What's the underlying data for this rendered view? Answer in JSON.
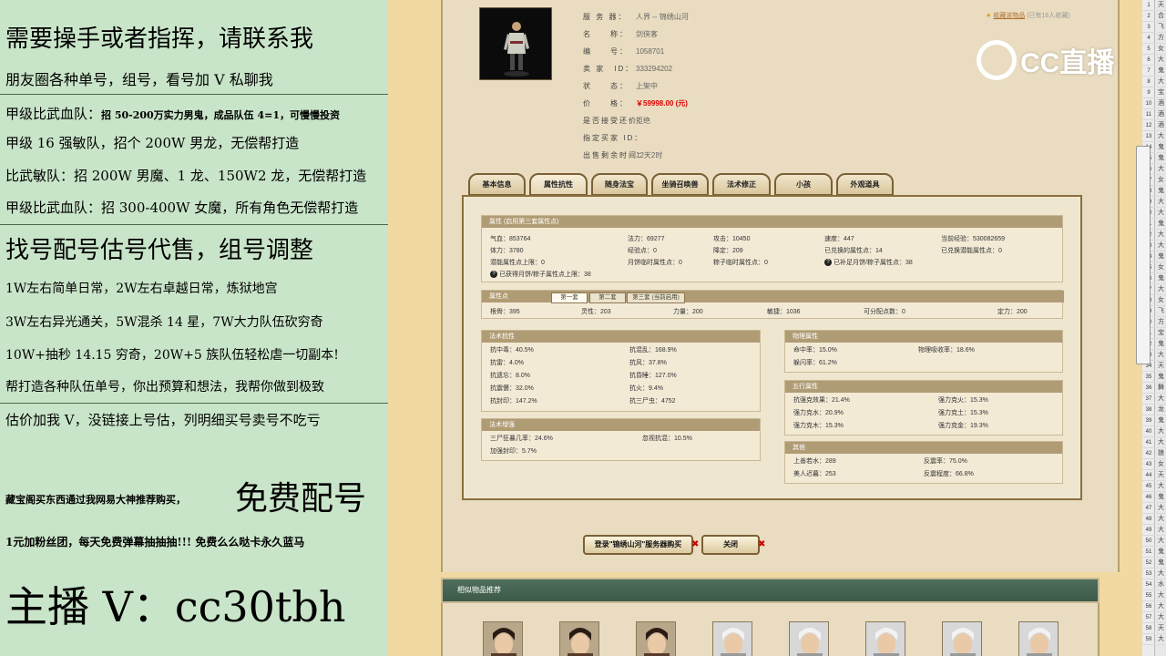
{
  "left_panel": {
    "title": "需要操手或者指挥，请联系我",
    "line1": "朋友圈各种单号，组号，看号加 V 私聊我",
    "recruit": [
      {
        "prefix": "甲级比武血队：",
        "text": "招 50-200万实力男鬼，成品队伍 4=1，可慢慢投资"
      },
      {
        "prefix": "",
        "text": "甲级 16 强敏队，招个 200W 男龙，无偿帮打造"
      },
      {
        "prefix": "",
        "text": "比武敏队：招 200W 男魔、1 龙、150W2 龙，无偿帮打造"
      },
      {
        "prefix": "",
        "text": "甲级比武血队：招 300-400W 女魔，所有角色无偿帮打造"
      }
    ],
    "title2": "找号配号估号代售，组号调整",
    "service": [
      "1W左右简单日常，2W左右卓越日常，炼狱地宫",
      "3W左右异光通关，5W混杀 14 星，7W大力队伍砍穷奇",
      "10W+抽秒 14.15 穷奇，20W+5 族队伍轻松虐一切副本!",
      "帮打造各种队伍单号，你出预算和想法，我帮你做到极致"
    ],
    "line_eval": "估价加我 V，没链接上号估，列明细买号卖号不吃亏",
    "cbg_small": "藏宝阁买东西通过我网易大神推荐购买，",
    "cbg_big": "免费配号",
    "fans": "1元加粉丝团，每天免费弹幕抽抽抽!!! 免费么么哒卡永久蓝马",
    "anchor": "主播 V：cc30tbh"
  },
  "item": {
    "rows": [
      {
        "label": "服 务 器：",
        "value": "人界 -- 锦绣山河"
      },
      {
        "label": "名　　称：",
        "value": "剑侠客"
      },
      {
        "label": "编　　号：",
        "value": "1058701"
      },
      {
        "label": "卖 家　ID：",
        "value": "333294202"
      },
      {
        "label": "状　　态：",
        "value": "上架中"
      },
      {
        "label": "价　　格：",
        "value": "￥59998.00 (元)"
      },
      {
        "label": "是否接受还价：",
        "value": "拒绝"
      },
      {
        "label": "指定买家 ID：",
        "value": ""
      },
      {
        "label": "出售剩余时间：",
        "value": "12天2时"
      }
    ],
    "fav_link": "收藏该物品",
    "fav_count": "(已有16人收藏)"
  },
  "tabs": [
    "基本信息",
    "属性抗性",
    "随身法宝",
    "坐骑召唤兽",
    "法术修正",
    "小孩",
    "外观道具"
  ],
  "attr": {
    "header": "属性 (启用第三套属性点)",
    "cells": [
      "气血：853764",
      "法力：69277",
      "攻击：10450",
      "速度：447",
      "当前经验：530082659",
      "体力：3780",
      "经验点：0",
      "降定：209",
      "已兑换的属性点：14",
      "已兑换潜能属性点：0",
      "潜能属性点上限：0",
      "月饼临时属性点：0",
      "粽子临时属性点：0",
      "已补足月饼/粽子属性点：38",
      "已获得月饼/粽子属性点上限：38"
    ]
  },
  "points": {
    "header": "属性点",
    "tabs": [
      "第一套",
      "第二套",
      "第三套 (当前启用)"
    ],
    "cells": [
      "根骨：395",
      "灵性：203",
      "力量：200",
      "敏捷：1036",
      "可分配点数：0",
      "定力：200"
    ]
  },
  "spell_res": {
    "header": "法术抗性",
    "cells": [
      "抗中毒：40.5%",
      "抗混乱：168.9%",
      "抗雷：4.0%",
      "抗风：37.8%",
      "抗遗忘：8.0%",
      "抗昏睡：127.0%",
      "抗震慑：32.0%",
      "抗火：9.4%",
      "抗封印：147.2%",
      "抗三尸虫：4752"
    ]
  },
  "phys": {
    "header": "物理属性",
    "cells": [
      "命中率：15.0%",
      "物理吸收率：18.6%",
      "躲闪率：61.2%"
    ]
  },
  "spell_boost": {
    "header": "法术增强",
    "cells": [
      "三尸狂暴几率：24.6%",
      "忽视抗混：10.5%",
      "加强封印：5.7%"
    ]
  },
  "wuxing": {
    "header": "五行属性",
    "cells": [
      "抗强克效果：21.4%",
      "强力克火：15.3%",
      "强力克水：20.9%",
      "强力克土：15.3%",
      "强力克木：15.3%",
      "强力克金：19.3%"
    ]
  },
  "other": {
    "header": "其他",
    "cells": [
      "上善若水：289",
      "反震率：75.0%",
      "美人迟暮：253",
      "反震程度：66.8%"
    ]
  },
  "buttons": {
    "login": "登录\"锦绣山河\"服务器购买",
    "close": "关闭"
  },
  "similar_title": "相似物品推荐",
  "logo_text": "CC直播",
  "strip": {
    "rows": [
      "1",
      "2",
      "3",
      "4",
      "5",
      "6",
      "7",
      "8",
      "9",
      "10",
      "11",
      "12",
      "13",
      "14",
      "15",
      "16",
      "17",
      "18",
      "19",
      "20",
      "21",
      "22",
      "23",
      "24",
      "25",
      "26",
      "27",
      "28",
      "29",
      "30",
      "31",
      "32",
      "33",
      "34",
      "35",
      "36",
      "37",
      "38",
      "39",
      "40",
      "41",
      "42",
      "43",
      "44",
      "45",
      "46",
      "47",
      "48",
      "49",
      "50",
      "51",
      "52",
      "53",
      "54",
      "55",
      "56",
      "57",
      "58",
      "59"
    ],
    "glyphs": [
      "天",
      "合",
      "飞",
      "方",
      "女",
      "大",
      "鬼",
      "大",
      "宝",
      "酒",
      "酒",
      "酒",
      "大",
      "鬼",
      "鬼",
      "大",
      "女",
      "鬼",
      "大",
      "大",
      "鬼",
      "大",
      "大",
      "鬼",
      "女",
      "鬼",
      "大",
      "女",
      "飞",
      "方",
      "宝",
      "鬼",
      "大",
      "天",
      "鬼",
      "舞",
      "大",
      "龙",
      "鬼",
      "大",
      "大",
      "狼",
      "女",
      "天",
      "大",
      "鬼",
      "大",
      "大",
      "大",
      "大",
      "鬼",
      "鬼",
      "大",
      "水",
      "大",
      "大",
      "大",
      "天",
      "大"
    ]
  },
  "colors": {
    "left_bg": "#c9e5c9",
    "page_bg": "#f0d9a2",
    "price": "#dd0000",
    "header_bar": "#b09c74",
    "similar_bar": "#4f6e5c"
  }
}
